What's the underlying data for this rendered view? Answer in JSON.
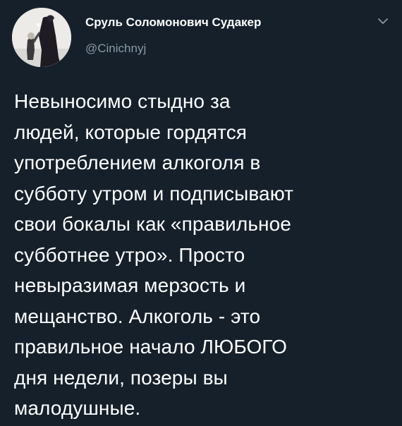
{
  "author": {
    "display_name": "Сруль Соломонович Судакер",
    "handle": "@Cinichnyj",
    "avatar_icon": "avatar-photo"
  },
  "menu": {
    "icon": "chevron-down-icon"
  },
  "tweet": {
    "lines": [
      "Невыносимо стыдно за",
      "людей, которые гордятся",
      "употреблением алкоголя в",
      "субботу утром и подписывают",
      "свои бокалы как «правильное",
      "субботнее утро». Просто",
      "невыразимая мерзость и",
      "мещанство. Алкоголь - это",
      "правильное начало ЛЮБОГО",
      "дня недели, позеры вы",
      "малодушные."
    ]
  },
  "colors": {
    "background": "#15202b",
    "text": "#ffffff",
    "secondary": "#8899a6"
  }
}
